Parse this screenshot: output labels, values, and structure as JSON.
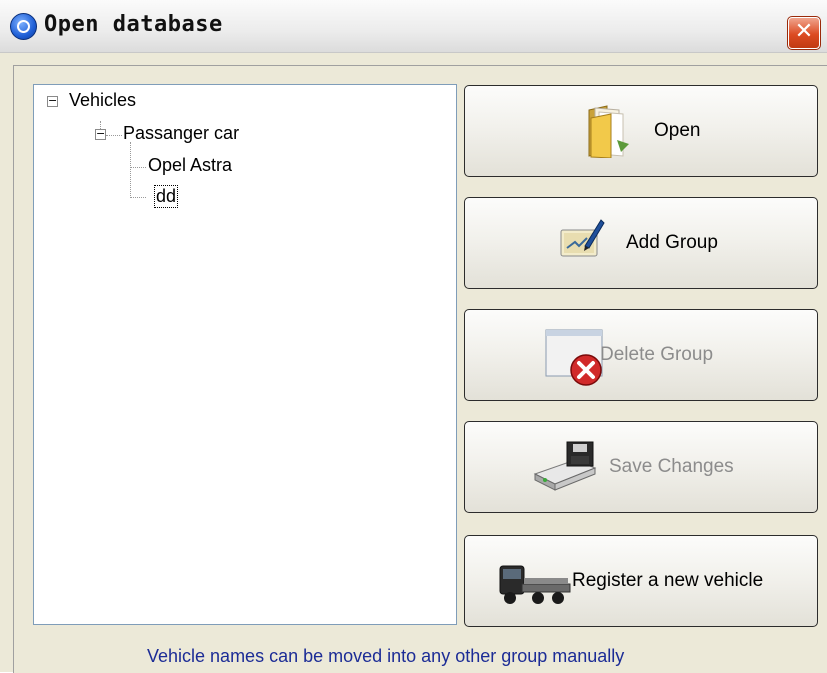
{
  "window": {
    "title": "Open database",
    "close_glyph": "✕"
  },
  "tree": {
    "root": {
      "label": "Vehicles",
      "expander": "−"
    },
    "group": {
      "label": "Passanger car",
      "expander": "−"
    },
    "items": [
      {
        "label": "Opel Astra"
      },
      {
        "label": "dd",
        "selected": true
      }
    ]
  },
  "buttons": {
    "open": {
      "label": "Open",
      "icon": "folder-icon",
      "enabled": true
    },
    "add_group": {
      "label": "Add Group",
      "icon": "edit-pen-icon",
      "enabled": true
    },
    "delete_group": {
      "label": "Delete Group",
      "icon": "delete-icon",
      "enabled": false
    },
    "save_changes": {
      "label": "Save Changes",
      "icon": "save-drive-icon",
      "enabled": false
    },
    "register_vehicle": {
      "label": "Register a new vehicle",
      "icon": "truck-icon",
      "enabled": true
    }
  },
  "footer": {
    "hint": "Vehicle names can be moved into any other group manually"
  },
  "colors": {
    "hint_text": "#1c2c96",
    "close_button": "#dc4b22"
  }
}
